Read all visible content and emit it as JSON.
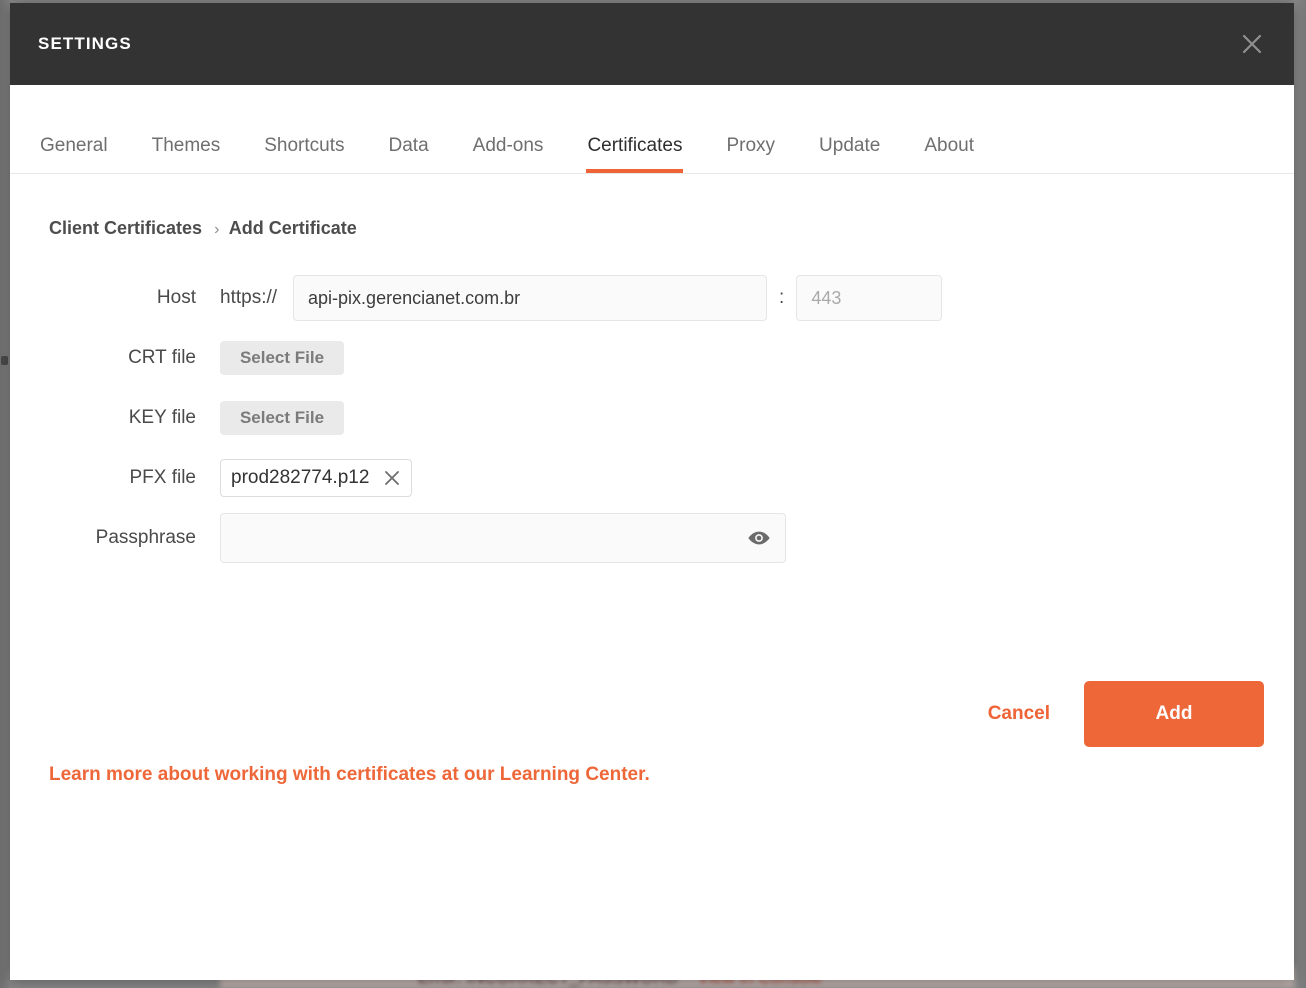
{
  "window": {
    "title": "SETTINGS",
    "close_icon": "close-icon"
  },
  "tabs": [
    {
      "label": "General",
      "active": false
    },
    {
      "label": "Themes",
      "active": false
    },
    {
      "label": "Shortcuts",
      "active": false
    },
    {
      "label": "Data",
      "active": false
    },
    {
      "label": "Add-ons",
      "active": false
    },
    {
      "label": "Certificates",
      "active": true
    },
    {
      "label": "Proxy",
      "active": false
    },
    {
      "label": "Update",
      "active": false
    },
    {
      "label": "About",
      "active": false
    }
  ],
  "breadcrumb": {
    "root": "Client Certificates",
    "separator": "›",
    "current": "Add Certificate"
  },
  "form": {
    "host": {
      "label": "Host",
      "protocol": "https://",
      "value": "api-pix.gerencianet.com.br",
      "placeholder": "",
      "colon": ":",
      "port_value": "",
      "port_placeholder": "443"
    },
    "crt": {
      "label": "CRT file",
      "button_label": "Select File"
    },
    "key": {
      "label": "KEY file",
      "button_label": "Select File"
    },
    "pfx": {
      "label": "PFX file",
      "file_name": "prod282774.p12",
      "clear_icon": "close-icon"
    },
    "passphrase": {
      "label": "Passphrase",
      "value": "",
      "placeholder": "",
      "reveal_icon": "eye-icon"
    }
  },
  "actions": {
    "cancel_label": "Cancel",
    "add_label": "Add"
  },
  "footer": {
    "learn_more": "Learn more about working with certificates at our Learning Center."
  },
  "background": {
    "error_text": "Error: INCORRECT_PASSWORD",
    "error_link": "View in Console"
  },
  "colors": {
    "accent": "#ee6739",
    "header_bg": "#333333",
    "tab_active_text": "#2e2e2e",
    "tab_text": "#6f6f6f",
    "label_text": "#4a4a4a",
    "input_bg": "#fafafa",
    "button_grey": "#eaeaea"
  }
}
